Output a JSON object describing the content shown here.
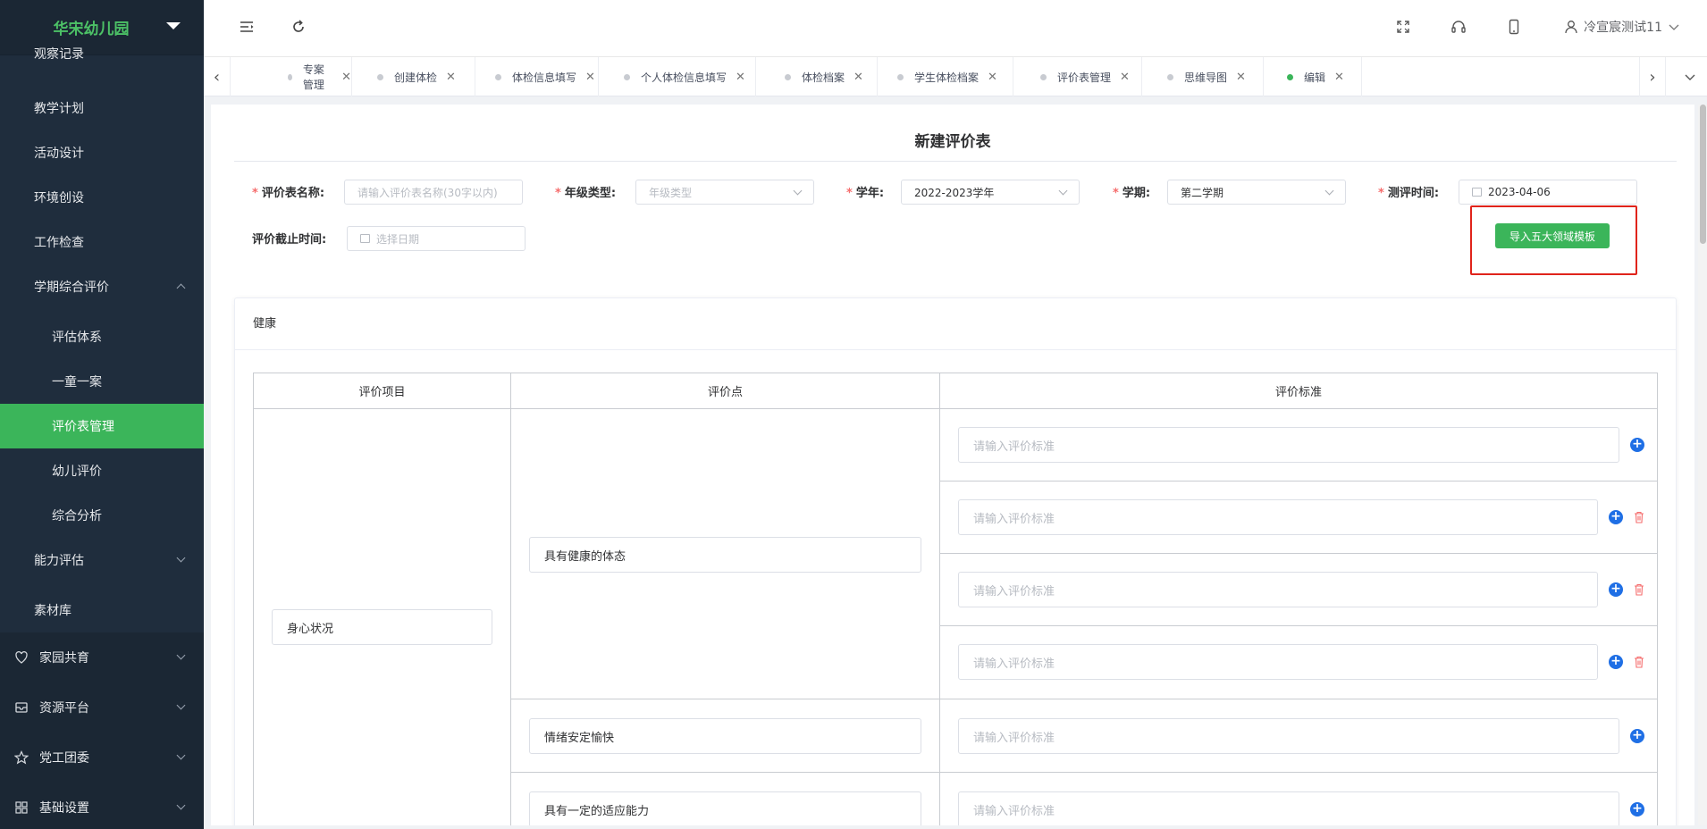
{
  "sidebar": {
    "logo": "华宋幼儿园",
    "items": [
      {
        "label": "观察记录"
      },
      {
        "label": "教学计划"
      },
      {
        "label": "活动设计"
      },
      {
        "label": "环境创设"
      },
      {
        "label": "工作检查"
      },
      {
        "label": "学期综合评价"
      },
      {
        "label": "评估体系"
      },
      {
        "label": "一童一案"
      },
      {
        "label": "评价表管理"
      },
      {
        "label": "幼儿评价"
      },
      {
        "label": "综合分析"
      },
      {
        "label": "能力评估"
      },
      {
        "label": "素材库"
      },
      {
        "label": "家园共育"
      },
      {
        "label": "资源平台"
      },
      {
        "label": "党工团委"
      },
      {
        "label": "基础设置"
      }
    ]
  },
  "header": {
    "user": "冷宣宸测试11"
  },
  "tabs": [
    {
      "label": "专案管理"
    },
    {
      "label": "创建体检"
    },
    {
      "label": "体检信息填写"
    },
    {
      "label": "个人体检信息填写"
    },
    {
      "label": "体检档案"
    },
    {
      "label": "学生体检档案"
    },
    {
      "label": "评价表管理"
    },
    {
      "label": "思维导图"
    },
    {
      "label": "编辑"
    }
  ],
  "form": {
    "title": "新建评价表",
    "name_label": "评价表名称:",
    "name_placeholder": "请输入评价表名称(30字以内)",
    "grade_label": "年级类型:",
    "grade_placeholder": "年级类型",
    "year_label": "学年:",
    "year_value": "2022-2023学年",
    "term_label": "学期:",
    "term_value": "第二学期",
    "test_time_label": "测评时间:",
    "test_time_value": "2023-04-06",
    "deadline_label": "评价截止时间:",
    "deadline_placeholder": "选择日期",
    "import_button": "导入五大领域模板"
  },
  "section": {
    "title": "健康",
    "columns": [
      "评价项目",
      "评价点",
      "评价标准"
    ],
    "project": "身心状况",
    "points": [
      "具有健康的体态",
      "情绪安定愉快",
      "具有一定的适应能力"
    ],
    "standard_placeholder": "请输入评价标准"
  },
  "colors": {
    "accent": "#3bb55a",
    "sidebar_bg": "#1f2d3d",
    "plus_blue": "#1f6fe5",
    "danger": "#f56c6c",
    "highlight": "#e0241b"
  }
}
